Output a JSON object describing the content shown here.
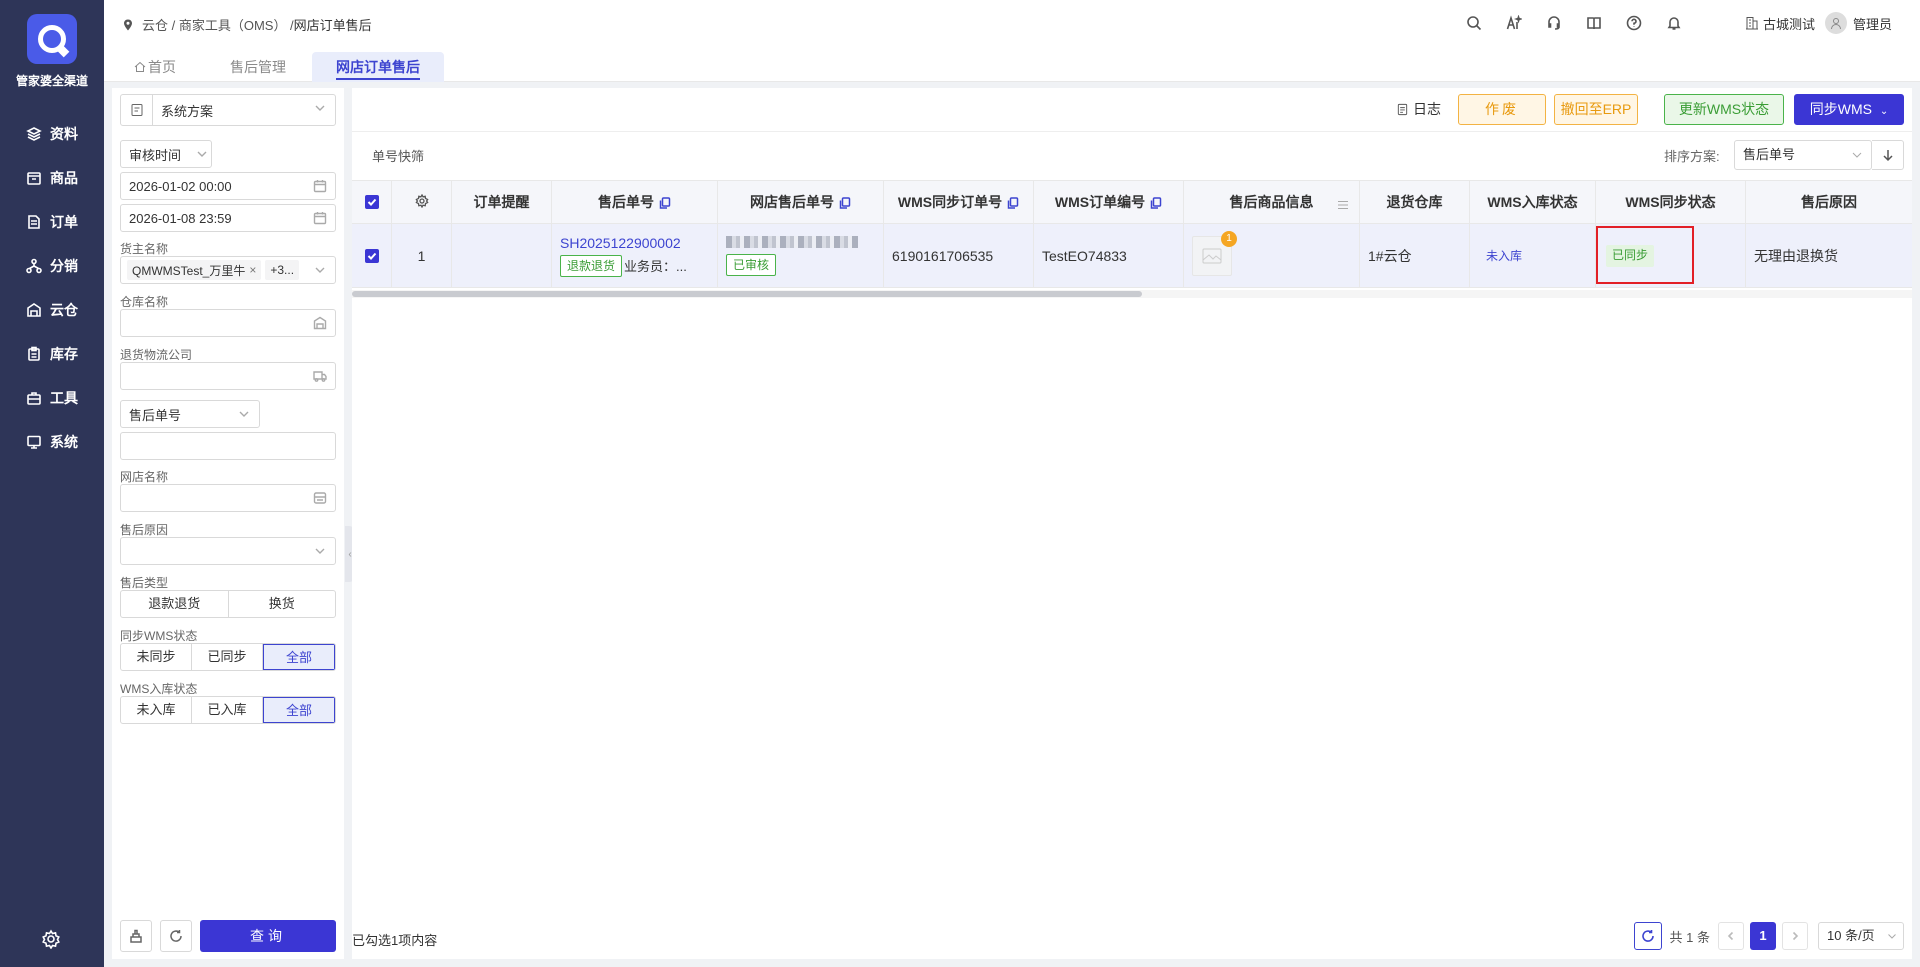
{
  "sidebar": {
    "logo_text": "管家婆全渠道",
    "items": [
      {
        "label": "资料",
        "icon": "layers-icon"
      },
      {
        "label": "商品",
        "icon": "box-icon"
      },
      {
        "label": "订单",
        "icon": "document-icon"
      },
      {
        "label": "分销",
        "icon": "network-icon"
      },
      {
        "label": "云仓",
        "icon": "cloud-warehouse-icon"
      },
      {
        "label": "库存",
        "icon": "clipboard-icon"
      },
      {
        "label": "工具",
        "icon": "toolbox-icon"
      },
      {
        "label": "系统",
        "icon": "monitor-icon"
      }
    ]
  },
  "header": {
    "breadcrumb": "云仓 / 商家工具（OMS） / ",
    "breadcrumb_current": "网店订单售后",
    "org": "古城测试",
    "user": "管理员"
  },
  "tabs": [
    {
      "label": "首页"
    },
    {
      "label": "售后管理"
    },
    {
      "label": "网店订单售后"
    }
  ],
  "filters": {
    "scheme": "系统方案",
    "time_type": "审核时间",
    "date_start": "2026-01-02 00:00",
    "date_end": "2026-01-08 23:59",
    "owner_label": "货主名称",
    "owner_tag": "QMWMSTest_万里牛",
    "owner_more": "+3...",
    "warehouse_label": "仓库名称",
    "logistics_label": "退货物流公司",
    "order_type": "售后单号",
    "shop_label": "网店名称",
    "reason_label": "售后原因",
    "type_label": "售后类型",
    "type_options": [
      "退款退货",
      "换货"
    ],
    "wms_sync_label": "同步WMS状态",
    "wms_sync_options": [
      "未同步",
      "已同步",
      "全部"
    ],
    "wms_in_label": "WMS入库状态",
    "wms_in_options": [
      "未入库",
      "已入库",
      "全部"
    ],
    "query_label": "查询"
  },
  "toolbar": {
    "log": "日志",
    "void": "作废",
    "revoke_erp": "撤回至ERP",
    "update_wms": "更新WMS状态",
    "sync_wms": "同步WMS"
  },
  "quick": {
    "label": "单号快筛",
    "sort_label": "排序方案:",
    "sort_value": "售后单号"
  },
  "table": {
    "headers": {
      "reminder": "订单提醒",
      "aftersale_no": "售后单号",
      "shop_aftersale_no": "网店售后单号",
      "wms_sync_no": "WMS同步订单号",
      "wms_order_no": "WMS订单编号",
      "goods_info": "售后商品信息",
      "return_wh": "退货仓库",
      "wms_in_status": "WMS入库状态",
      "wms_sync_status": "WMS同步状态",
      "reason": "售后原因"
    },
    "rows": [
      {
        "index": "1",
        "aftersale_no": "SH2025122900002",
        "type_tag": "退款退货",
        "salesman": "业务员：...",
        "shop_status": "已审核",
        "wms_sync_no": "6190161706535",
        "wms_order_no": "TestEO74833",
        "goods_count": "1",
        "return_wh": "1#云仓",
        "wms_in_status": "未入库",
        "wms_sync_status": "已同步",
        "reason": "无理由退换货"
      }
    ]
  },
  "footer": {
    "selected": "已勾选1项内容",
    "total": "共 1 条",
    "page": "1",
    "page_size": "10 条/页"
  }
}
